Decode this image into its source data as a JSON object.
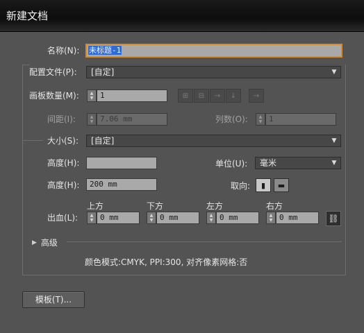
{
  "window": {
    "title": "新建文档"
  },
  "name": {
    "label": "名称(N):",
    "value": "未标题-1"
  },
  "profile": {
    "label": "配置文件(P):",
    "value": "[自定]"
  },
  "artboards": {
    "count_label": "画板数量(M):",
    "count_value": "1",
    "spacing_label": "间距(I):",
    "spacing_value": "7.06 mm",
    "columns_label": "列数(O):",
    "columns_value": "1"
  },
  "size": {
    "label": "大小(S):",
    "value": "[自定]"
  },
  "width": {
    "label": "高度(H):",
    "value": ""
  },
  "units": {
    "label": "单位(U):",
    "value": "毫米"
  },
  "height": {
    "label": "高度(H):",
    "value": "200 mm"
  },
  "orientation": {
    "label": "取向:"
  },
  "bleed": {
    "label": "出血(L):",
    "top_label": "上方",
    "top_value": "0 mm",
    "bottom_label": "下方",
    "bottom_value": "0 mm",
    "left_label": "左方",
    "left_value": "0 mm",
    "right_label": "右方",
    "right_value": "0 mm"
  },
  "advanced": {
    "label": "高级"
  },
  "summary": {
    "text": "颜色模式:CMYK, PPI:300, 对齐像素网格:否"
  },
  "templates_button": {
    "label": "模板(T)..."
  },
  "colors": {
    "accent_focus": "#d68a2a",
    "selection": "#2f6bd2",
    "background": "#535353"
  },
  "icons": {
    "spin": "spinner-arrows-icon",
    "dropdown": "chevron-down-icon",
    "layout": [
      "grid-by-row-icon",
      "grid-by-column-icon",
      "arrange-by-row-icon",
      "arrange-by-column-icon",
      "right-to-left-icon"
    ],
    "orientation": [
      "portrait-icon",
      "landscape-icon"
    ],
    "link": "chain-link-icon",
    "disclosure": "triangle-right-icon"
  }
}
